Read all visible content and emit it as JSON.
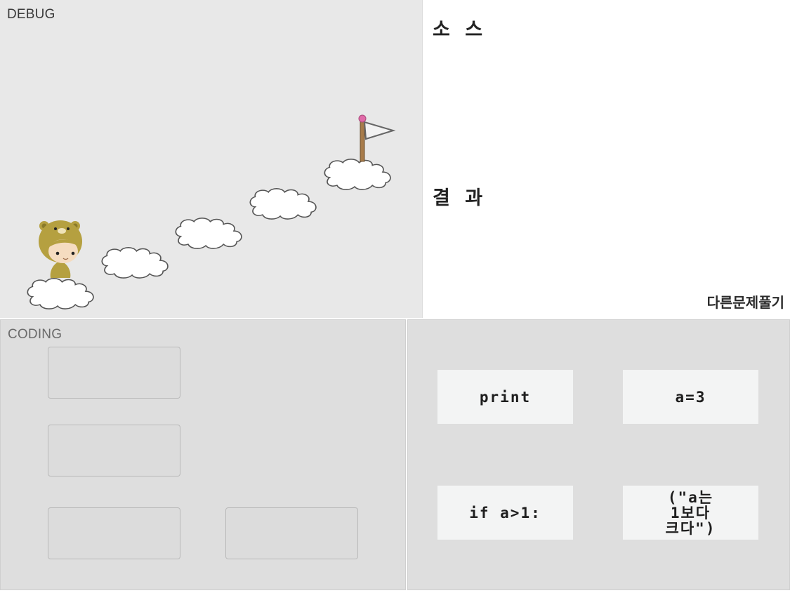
{
  "debug": {
    "label": "DEBUG"
  },
  "source": {
    "title": "소 스"
  },
  "result": {
    "title": "결 과"
  },
  "other_problem_label": "다른문제풀기",
  "coding": {
    "label": "CODING",
    "slots": 4
  },
  "blocks": {
    "items": [
      {
        "label": "print"
      },
      {
        "label": "a=3"
      },
      {
        "label": "if a>1:"
      },
      {
        "label": "(\"a는\n1보다\n크다\")"
      }
    ]
  },
  "icons": {
    "character": "bear-hood-character-icon",
    "cloud": "cloud-platform-icon",
    "flag": "goal-flag-icon"
  },
  "colors": {
    "debug_bg": "#e8e8e8",
    "panel_bg": "#dedede",
    "block_bg": "#f3f4f4",
    "flag_tip": "#e06aa8",
    "flag_pole": "#a77b4a",
    "character_hood": "#b5a040"
  }
}
